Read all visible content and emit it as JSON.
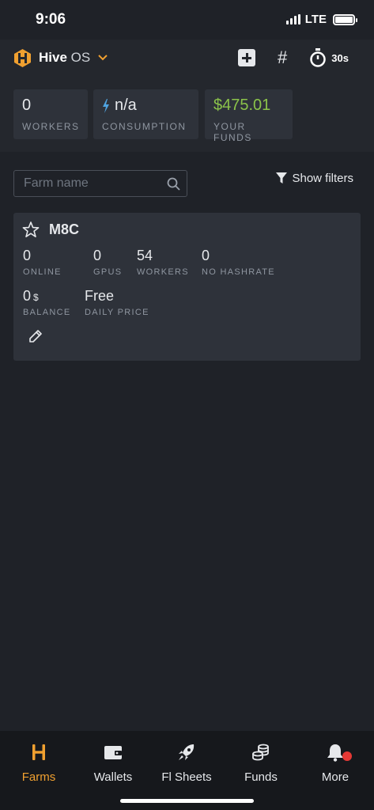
{
  "status_bar": {
    "time": "9:06",
    "network": "LTE"
  },
  "app_bar": {
    "brand_bold": "Hive",
    "brand_light": "OS",
    "timer_label": "30s",
    "hash_symbol": "#"
  },
  "stats": [
    {
      "value": "0",
      "label": "WORKERS"
    },
    {
      "value": "n/a",
      "label": "CONSUMPTION"
    },
    {
      "value": "$475.01",
      "label": "YOUR FUNDS"
    }
  ],
  "search": {
    "placeholder": "Farm name"
  },
  "filters": {
    "label": "Show filters"
  },
  "farm": {
    "name": "M8C",
    "metrics": [
      {
        "value": "0",
        "label": "ONLINE"
      },
      {
        "value": "0",
        "label": "GPUS"
      },
      {
        "value": "54",
        "label": "WORKERS"
      },
      {
        "value": "0",
        "label": "NO HASHRATE"
      }
    ],
    "balance": {
      "value": "0",
      "unit": "$",
      "label": "BALANCE"
    },
    "daily_price": {
      "value": "Free",
      "label": "DAILY PRICE"
    }
  },
  "tabs": [
    {
      "label": "Farms",
      "icon": "hive-logo-icon"
    },
    {
      "label": "Wallets",
      "icon": "wallet-icon"
    },
    {
      "label": "Fl Sheets",
      "icon": "rocket-icon"
    },
    {
      "label": "Funds",
      "icon": "coins-icon"
    },
    {
      "label": "More",
      "icon": "bell-icon"
    }
  ],
  "colors": {
    "accent": "#f0a030",
    "funds_green": "#8bc34a",
    "background": "#1f2228",
    "card": "#2e323a",
    "badge_red": "#e53935"
  }
}
